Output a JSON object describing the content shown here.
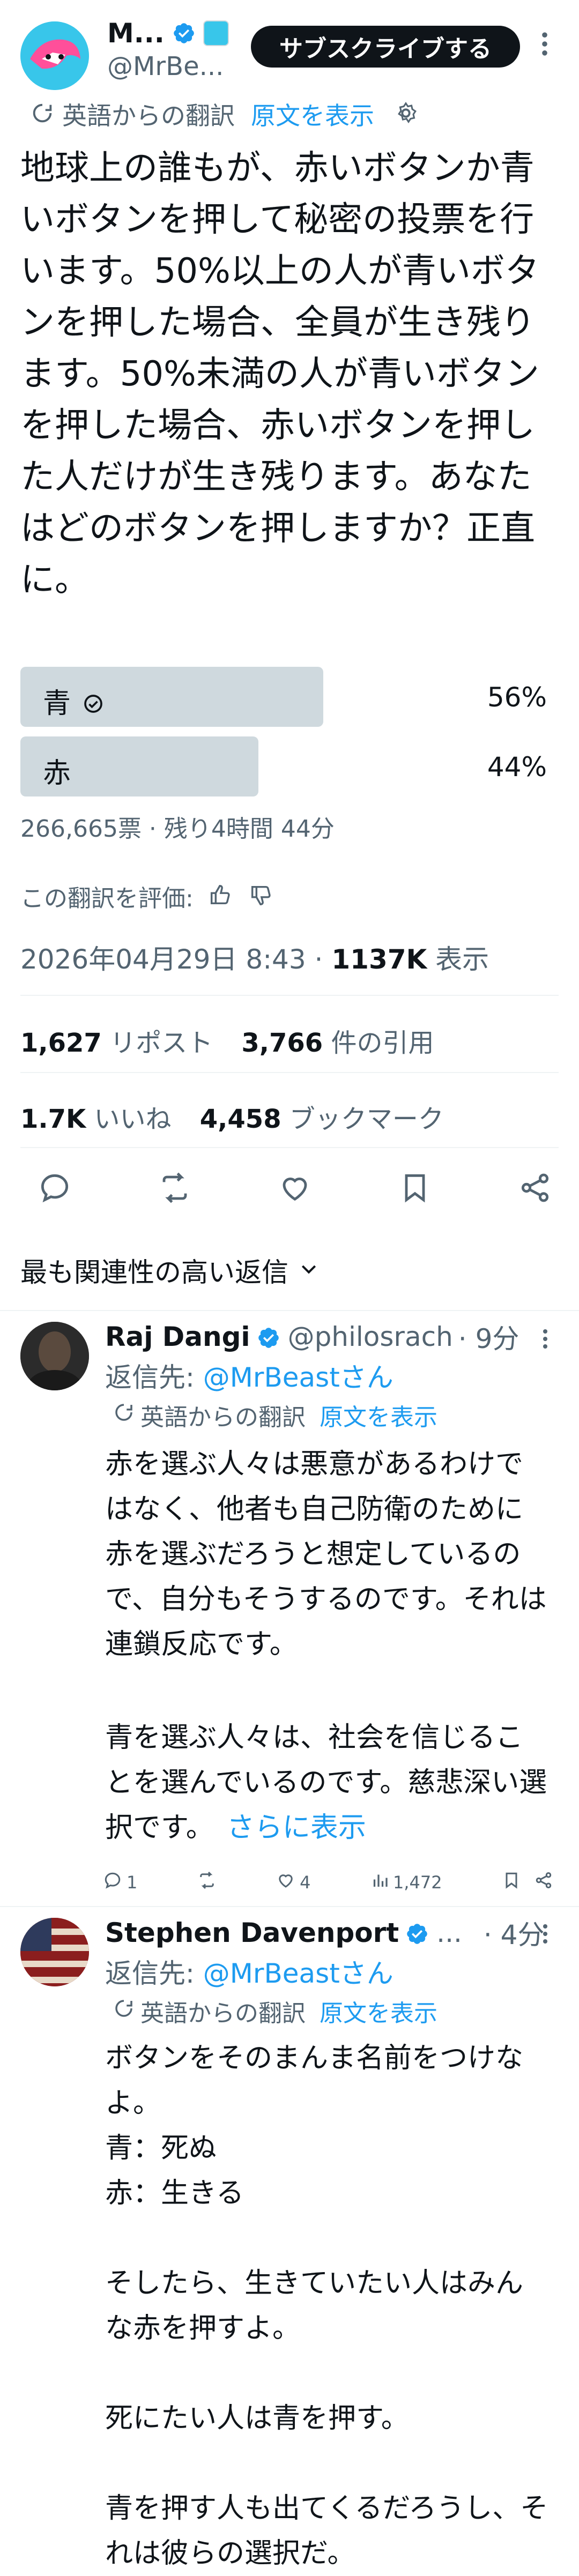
{
  "author": {
    "name": "M...",
    "handle": "@MrBe...",
    "subscribe_label": "サブスクライブする"
  },
  "translation": {
    "label": "英語からの翻訳",
    "show_original": "原文を表示",
    "rate_label": "この翻訳を評価:"
  },
  "tweet": {
    "text": "地球上の誰もが、赤いボタンか青いボタンを押して秘密の投票を行います。50%以上の人が青いボタンを押した場合、全員が生き残ります。50%未満の人が青いボタンを押した場合、赤いボタンを押した人だけが生き残ります。あなたはどのボタンを押しますか？正直に。",
    "timestamp": "2026年04月29日 8:43 · ",
    "views_count": "1137K",
    "views_label": " 表示",
    "reposts_count": "1,627",
    "reposts_label": " リポスト",
    "quotes_count": "3,766",
    "quotes_label": " 件の引用",
    "likes_count": "1.7K",
    "likes_label": " いいね",
    "bookmarks_count": "4,458",
    "bookmarks_label": " ブックマーク"
  },
  "poll": {
    "options": [
      {
        "label": "青",
        "percent": "56%",
        "share": 0.56,
        "selected": true
      },
      {
        "label": "赤",
        "percent": "44%",
        "share": 0.44,
        "selected": false
      }
    ],
    "meta": "266,665票 · 残り4時間 44分"
  },
  "replies_sort_label": "最も関連性の高い返信",
  "replies": [
    {
      "name": "Raj Dangi",
      "handle": "@philosrach",
      "time": "· 9分",
      "reply_to_prefix": "返信先: ",
      "reply_to": "@MrBeastさん",
      "text1": "赤を選ぶ人々は悪意があるわけではなく、他者も自己防衛のために赤を選ぶだろうと想定しているので、自分もそうするのです。それは連鎖反応です。",
      "text2": "青を選ぶ人々は、社会を信じることを選んでいるのです。慈悲深い選択です。",
      "show_more": "さらに表示",
      "stats": {
        "replies": "1",
        "reposts": "",
        "likes": "4",
        "views": "1,472"
      }
    },
    {
      "name": "Stephen Davenport",
      "handle": "...",
      "time": "· 4分",
      "reply_to_prefix": "返信先: ",
      "reply_to": "@MrBeastさん",
      "lines": [
        "ボタンをそのまんま名前をつけなよ。",
        "青：死ぬ",
        "赤：生きる",
        "",
        "そしたら、生きていたい人はみんな赤を押すよ。",
        "",
        "死にたい人は青を押す。",
        "",
        "青を押す人も出てくるだろうし、それは彼らの選択だ。"
      ]
    }
  ],
  "colors": {
    "accent": "#1d9bf0",
    "text": "#0f1419",
    "muted": "#536471",
    "poll_bar": "#cfd9de"
  }
}
